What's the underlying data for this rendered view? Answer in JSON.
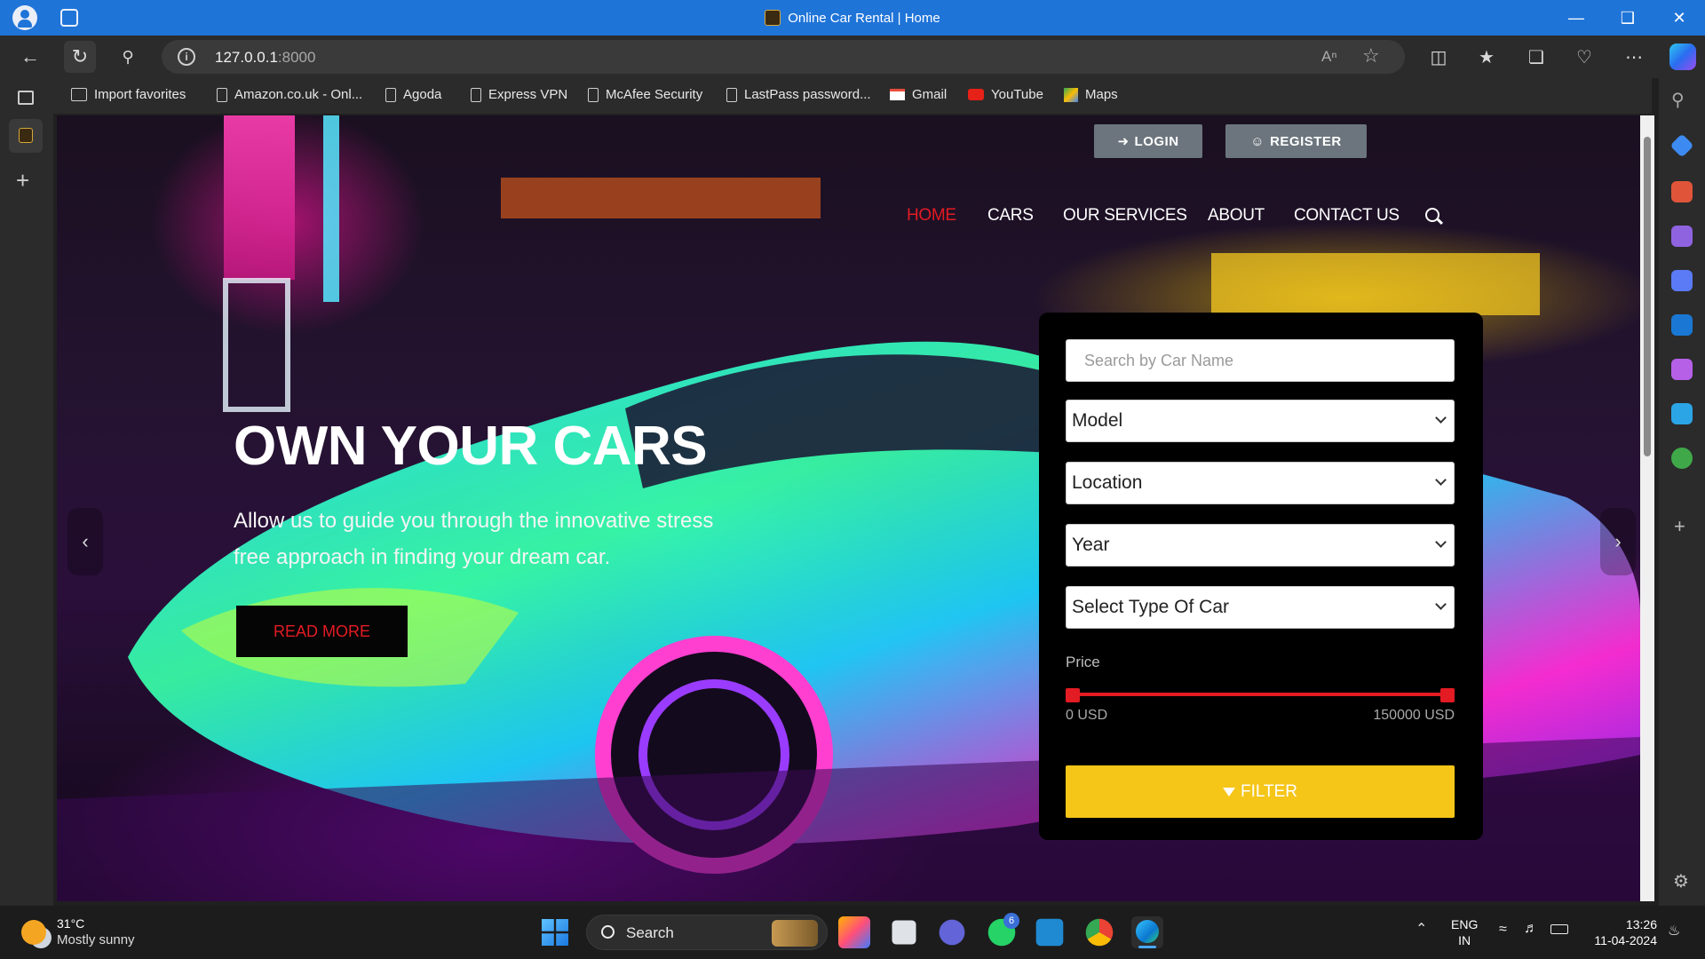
{
  "window": {
    "title": "Online Car Rental | Home"
  },
  "browser": {
    "url_host": "127.0.0.1",
    "url_port": ":8000",
    "favorites": [
      {
        "label": "Import favorites",
        "icon": "import-icon"
      },
      {
        "label": "Amazon.co.uk - Onl...",
        "icon": "document-icon"
      },
      {
        "label": "Agoda",
        "icon": "document-icon"
      },
      {
        "label": "Express VPN",
        "icon": "document-icon"
      },
      {
        "label": "McAfee Security",
        "icon": "document-icon"
      },
      {
        "label": "LastPass password...",
        "icon": "document-icon"
      },
      {
        "label": "Gmail",
        "icon": "gmail-icon"
      },
      {
        "label": "YouTube",
        "icon": "youtube-icon"
      },
      {
        "label": "Maps",
        "icon": "maps-icon"
      }
    ]
  },
  "site": {
    "auth": {
      "login": "LOGIN",
      "register": "REGISTER"
    },
    "nav": [
      {
        "label": "HOME",
        "active": true
      },
      {
        "label": "CARS",
        "active": false
      },
      {
        "label": "OUR SERVICES",
        "active": false
      },
      {
        "label": "ABOUT",
        "active": false
      },
      {
        "label": "CONTACT US",
        "active": false
      }
    ],
    "hero": {
      "title": "OWN YOUR CARS",
      "text": "Allow us to guide you through the innovative stress free approach in finding your dream car.",
      "button": "READ MORE"
    },
    "filter": {
      "search_placeholder": "Search by Car Name",
      "selects": [
        "Model",
        "Location",
        "Year",
        "Select Type Of Car"
      ],
      "price_label": "Price",
      "price_min": "0 USD",
      "price_max": "150000 USD",
      "button": "FILTER"
    },
    "colors": {
      "accent_red": "#e31b23",
      "filter_yellow": "#f5c518",
      "auth_gray": "#6c757d"
    }
  },
  "taskbar": {
    "weather_temp": "31°C",
    "weather_text": "Mostly sunny",
    "search_label": "Search",
    "whatsapp_badge": "6",
    "lang_top": "ENG",
    "lang_bottom": "IN",
    "time": "13:26",
    "date": "11-04-2024"
  }
}
